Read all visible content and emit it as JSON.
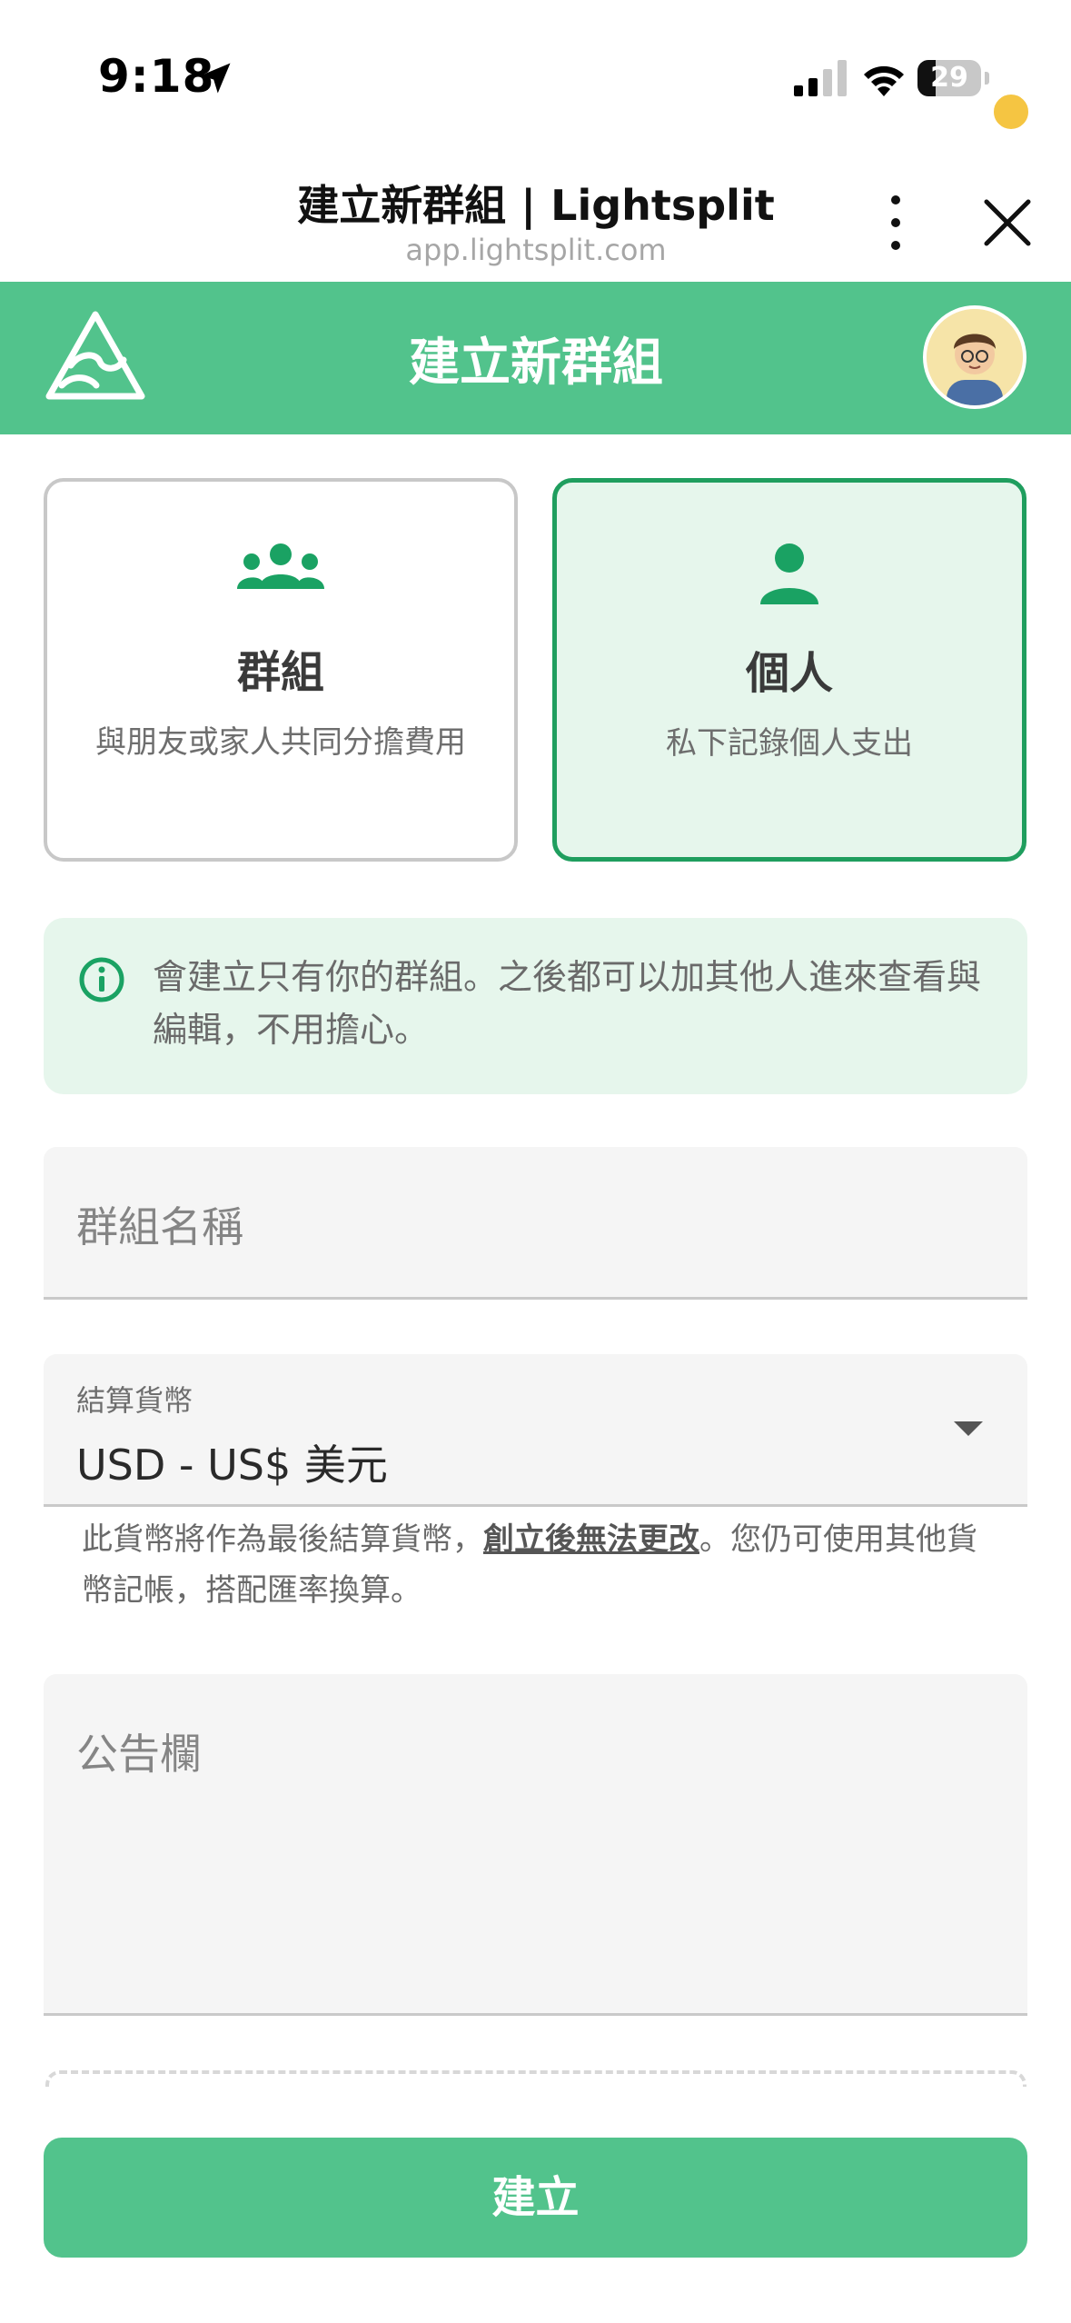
{
  "status_bar": {
    "time": "9:18",
    "battery_level": 29,
    "battery_label": "29"
  },
  "browser": {
    "title": "建立新群組 | Lightsplit",
    "url": "app.lightsplit.com"
  },
  "app_header": {
    "title": "建立新群組",
    "accent_color": "#52c38c"
  },
  "type_options": [
    {
      "title": "群組",
      "description": "與朋友或家人共同分擔費用",
      "icon": "group-icon",
      "selected": false
    },
    {
      "title": "個人",
      "description": "私下記錄個人支出",
      "icon": "person-icon",
      "selected": true
    }
  ],
  "info": {
    "text": "會建立只有你的群組。之後都可以加其他人進來查看與編輯，不用擔心。",
    "icon": "info-icon"
  },
  "form": {
    "group_name_placeholder": "群組名稱",
    "currency_label": "結算貨幣",
    "currency_value": "USD - US$ 美元",
    "currency_helper_pre": "此貨幣將作為最後結算貨幣，",
    "currency_helper_emph": "創立後無法更改",
    "currency_helper_post": "。您仍可使用其他貨幣記帳，搭配匯率換算。",
    "notes_placeholder": "公告欄"
  },
  "actions": {
    "create_label": "建立"
  },
  "colors": {
    "primary": "#52c38c",
    "selected_border": "#1f9e5e",
    "selected_bg": "#e6f6ec",
    "icon_green": "#1aa263"
  }
}
